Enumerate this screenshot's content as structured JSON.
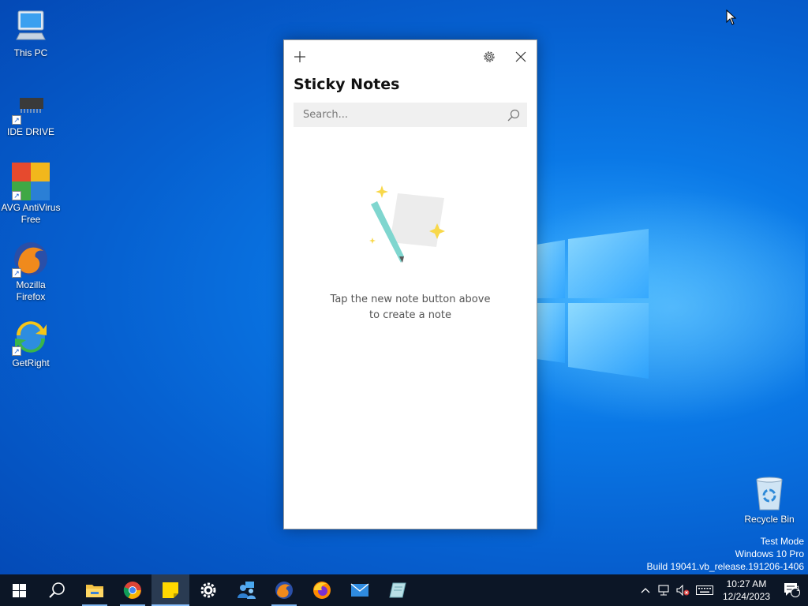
{
  "desktop": {
    "icons": [
      {
        "label": "This PC",
        "icon": "computer-icon"
      },
      {
        "label": "IDE DRIVE",
        "icon": "chip-icon"
      },
      {
        "label": "AVG AntiVirus Free",
        "icon": "avg-icon"
      },
      {
        "label": "Mozilla Firefox",
        "icon": "firefox-icon"
      },
      {
        "label": "GetRight",
        "icon": "getright-icon"
      }
    ],
    "recycle_bin": {
      "label": "Recycle Bin",
      "icon": "recycle-bin-icon"
    },
    "watermark": {
      "line1": "Test Mode",
      "line2": "Windows 10 Pro",
      "line3": "Build 19041.vb_release.191206-1406"
    }
  },
  "sticky_notes": {
    "title": "Sticky Notes",
    "new_note_icon": "plus-icon",
    "settings_icon": "gear-icon",
    "close_icon": "close-icon",
    "search": {
      "placeholder": "Search...",
      "value": ""
    },
    "empty_line1": "Tap the new note button above",
    "empty_line2": "to create a note"
  },
  "taskbar": {
    "items": [
      {
        "name": "start-button",
        "icon": "windows-icon"
      },
      {
        "name": "search-button",
        "icon": "search-icon"
      },
      {
        "name": "file-explorer",
        "icon": "folder-icon"
      },
      {
        "name": "chrome",
        "icon": "chrome-icon"
      },
      {
        "name": "sticky-notes",
        "icon": "sticky-notes-icon"
      },
      {
        "name": "settings",
        "icon": "gear-icon"
      },
      {
        "name": "people",
        "icon": "people-icon"
      },
      {
        "name": "firefox",
        "icon": "firefox-icon"
      },
      {
        "name": "firefox-alt",
        "icon": "firefox-icon"
      },
      {
        "name": "mail",
        "icon": "mail-icon"
      },
      {
        "name": "app",
        "icon": "app-icon"
      }
    ],
    "clock": {
      "time": "10:27 AM",
      "date": "12/24/2023"
    },
    "notification_count": "1"
  },
  "colors": {
    "desktop_bg": "#0a78e6",
    "taskbar_bg": "#0c1626",
    "sticky_yellow": "#ffd800"
  }
}
